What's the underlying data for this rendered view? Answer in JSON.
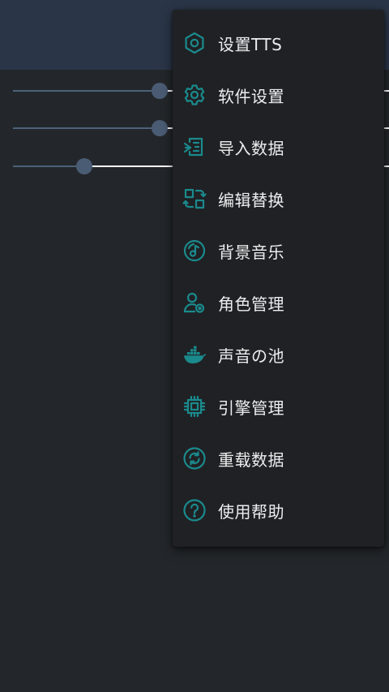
{
  "colors": {
    "app_bar": "#2a3547",
    "background": "#23272b",
    "menu_background": "#202124",
    "icon_accent": "#1a8a8d",
    "slider_thumb": "#4a5c74",
    "menu_text": "#ecedee"
  },
  "sliders": [
    {
      "name": "slider-1",
      "value_percent": 39
    },
    {
      "name": "slider-2",
      "value_percent": 39
    },
    {
      "name": "slider-3",
      "value_percent": 19
    }
  ],
  "menu": {
    "items": [
      {
        "id": "set-tts",
        "label": "设置TTS",
        "icon": "hexagon-nut-icon"
      },
      {
        "id": "app-settings",
        "label": "软件设置",
        "icon": "gear-icon"
      },
      {
        "id": "import-data",
        "label": "导入数据",
        "icon": "import-icon"
      },
      {
        "id": "edit-replace",
        "label": "编辑替换",
        "icon": "replace-icon"
      },
      {
        "id": "background-music",
        "label": "背景音乐",
        "icon": "music-disc-icon"
      },
      {
        "id": "role-management",
        "label": "角色管理",
        "icon": "user-gear-icon"
      },
      {
        "id": "voice-pool",
        "label": "声音の池",
        "icon": "docker-whale-icon"
      },
      {
        "id": "engine-management",
        "label": "引擎管理",
        "icon": "chip-icon"
      },
      {
        "id": "reload-data",
        "label": "重载数据",
        "icon": "refresh-circle-icon"
      },
      {
        "id": "help",
        "label": "使用帮助",
        "icon": "help-circle-icon"
      }
    ]
  }
}
